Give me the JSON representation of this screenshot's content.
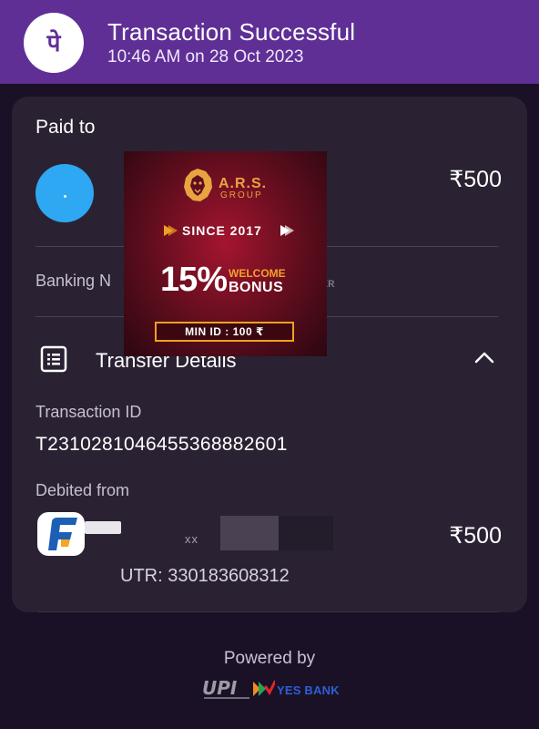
{
  "header": {
    "title": "Transaction Successful",
    "subtitle": "10:46 AM on 28 Oct 2023",
    "logo_icon": "phonepe-logo",
    "logo_glyph": "पे",
    "color": "#5f2f96"
  },
  "paid_to": {
    "label": "Paid to",
    "amount": "₹500",
    "avatar_color": "#2ea8f3"
  },
  "banking": {
    "label": "Banking N",
    "suffix": "kʀ"
  },
  "transfer_details": {
    "title": "Transfer Details",
    "expanded": true,
    "transaction_id_label": "Transaction ID",
    "transaction_id": "T2310281046455368882601",
    "debited_from_label": "Debited from",
    "debited_amount": "₹500",
    "masked_account": "xx",
    "utr": "UTR: 330183608312"
  },
  "footer": {
    "powered_by": "Powered by",
    "upi_logo": "UPI",
    "bank": "YES BANK"
  },
  "ad": {
    "brand": "A.R.S.",
    "brand_sub": "GROUP",
    "since": "SINCE 2017",
    "percent": "15%",
    "welcome": "WELCOME",
    "bonus": "BONUS",
    "min_id": "MIN ID : 100 ₹"
  },
  "colors": {
    "background": "#1b1126",
    "card": "#2a2232",
    "accent_gold": "#f0a020"
  }
}
